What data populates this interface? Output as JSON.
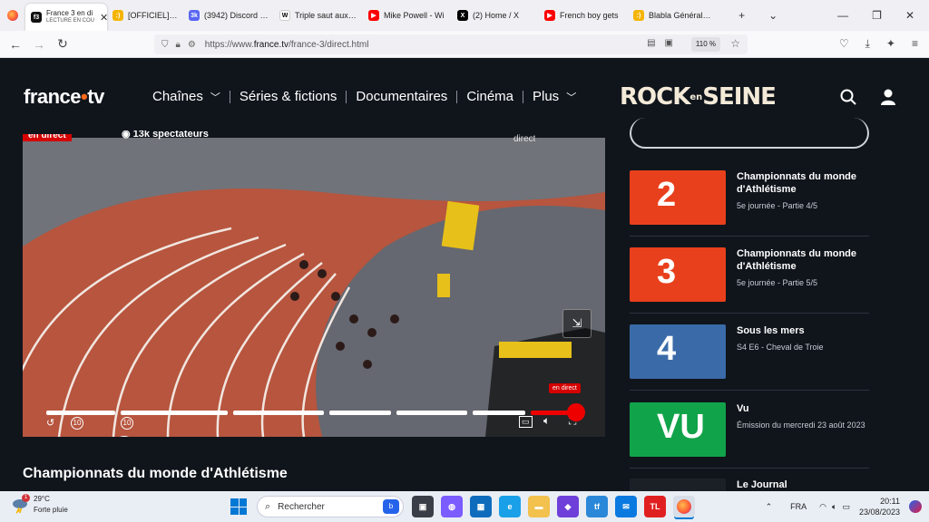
{
  "browser": {
    "tabs": [
      {
        "title": "France 3 en di",
        "subtitle": "LECTURE EN COU",
        "active": true,
        "fav_color": "#111111",
        "fav_text": "f3"
      },
      {
        "title": "[OFFICIEL] Cham",
        "fav_color": "#f5b400",
        "fav_text": ":)"
      },
      {
        "title": "(3942) Discord | #",
        "fav_color": "#5865f2",
        "fav_text": "3k"
      },
      {
        "title": "Triple saut aux ch",
        "fav_color": "#ffffff",
        "fav_text": "W"
      },
      {
        "title": "Mike Powell - Wi",
        "fav_color": "#ff0000",
        "fav_text": "▶"
      },
      {
        "title": "(2) Home / X",
        "fav_color": "#000000",
        "fav_text": "X"
      },
      {
        "title": "French boy gets",
        "fav_color": "#ff0000",
        "fav_text": "▶"
      },
      {
        "title": "Blabla Général su",
        "fav_color": "#f5b400",
        "fav_text": ":)"
      }
    ],
    "url_prefix": "https://www.",
    "url_domain": "france.tv",
    "url_path": "/france-3/direct.html",
    "zoom": "110 %"
  },
  "site": {
    "logo_a": "france",
    "logo_dot": "•",
    "logo_b": "tv",
    "menu": [
      "Chaînes",
      "Séries & fictions",
      "Documentaires",
      "Cinéma",
      "Plus"
    ],
    "promo_a": "ROCK",
    "promo_en": "en",
    "promo_b": "SEINE"
  },
  "player": {
    "live_badge": "en direct",
    "viewers": "13k spectateurs",
    "channel": "direct",
    "live_tip": "en direct",
    "rewind_label": "10",
    "forward_label": "10"
  },
  "program_title": "Championnats du monde d'Athlétisme",
  "sidebar": [
    {
      "num": "2",
      "title": "Championnats du monde d'Athlétisme",
      "sub": "5e journée - Partie 4/5",
      "thumb_color": "#e8401c"
    },
    {
      "num": "3",
      "title": "Championnats du monde d'Athlétisme",
      "sub": "5e journée - Partie 5/5",
      "thumb_color": "#e8401c"
    },
    {
      "num": "4",
      "title": "Sous les mers",
      "sub": "S4 E6 - Cheval de Troie",
      "thumb_color": "#3a6aa8"
    },
    {
      "num": "VU",
      "title": "Vu",
      "sub": "Émission du mercredi 23 août 2023",
      "thumb_color": "#11a34a"
    },
    {
      "num": "",
      "title": "Le Journal",
      "sub": "",
      "thumb_color": "#1b1f26"
    }
  ],
  "taskbar": {
    "temp": "29°C",
    "weather": "Forte pluie",
    "badge": "1",
    "search": "Rechercher",
    "lang": "FRA",
    "time": "20:11",
    "date": "23/08/2023"
  }
}
